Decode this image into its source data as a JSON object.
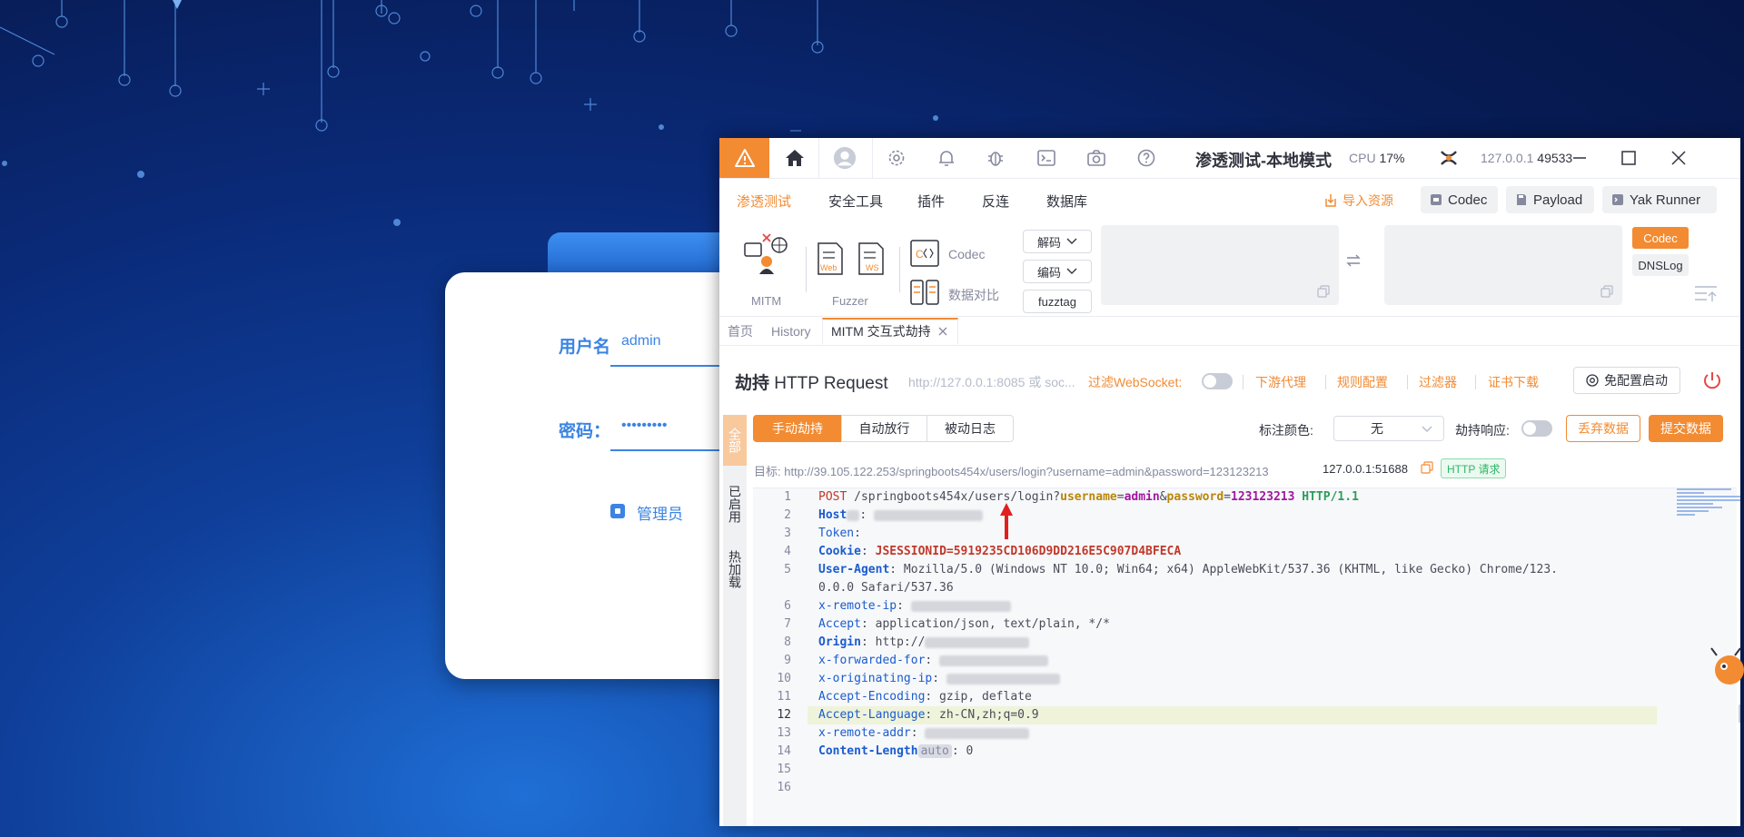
{
  "login": {
    "username_label": "用户名",
    "username_value": "admin",
    "password_label": "密码：",
    "password_value": "•••••••••",
    "role_label": "管理员"
  },
  "titlebar": {
    "title": "渗透测试-本地模式",
    "cpu_label": "CPU",
    "cpu_value": "17%",
    "address": "127.0.0.1",
    "port": "49533"
  },
  "menu": {
    "items": [
      "渗透测试",
      "安全工具",
      "插件",
      "反连",
      "数据库"
    ],
    "import_label": "导入资源",
    "codec_label": "Codec",
    "payload_label": "Payload",
    "yakrunner_label": "Yak Runner"
  },
  "tools": {
    "mitm_label": "MITM",
    "fuzzer_label": "Fuzzer",
    "codec_label": "Codec",
    "compare_label": "数据对比",
    "decode_label": "解码",
    "encode_label": "编码",
    "fuzztag_label": "fuzztag",
    "side_codec": "Codec",
    "side_dnslog": "DNSLog"
  },
  "tabs": [
    "首页",
    "History",
    "MITM 交互式劫持"
  ],
  "hijack": {
    "title_bold": "劫持",
    "title_rest": " HTTP Request",
    "placeholder": "http://127.0.0.1:8085 或 soc...",
    "ws_label": "过滤WebSocket:",
    "downstream": "下游代理",
    "rules": "规则配置",
    "filter": "过滤器",
    "cert": "证书下载",
    "free_start": "免配置启动"
  },
  "vtabs": [
    "全部",
    "已启用",
    "热加载"
  ],
  "modes": [
    "手动劫持",
    "自动放行",
    "被动日志"
  ],
  "actions": {
    "color_label": "标注颜色:",
    "color_value": "无",
    "hijack_resp_label": "劫持响应:",
    "discard": "丢弃数据",
    "submit": "提交数据"
  },
  "target": {
    "label": "目标:",
    "url": "http://39.105.122.253/springboots454x/users/login?username=admin&password=123123213",
    "source": "127.0.0.1:51688",
    "tag": "HTTP 请求"
  },
  "request": {
    "method": "POST",
    "path": "/springboots454x/users/login?",
    "p1k": "username",
    "p1v": "admin",
    "p2k": "password",
    "p2v": "123123213",
    "version": "HTTP/1.1",
    "h_host": "Host",
    "h_token": "Token",
    "h_cookie": "Cookie",
    "cookie_val": "JSESSIONID=5919235CD106D9DD216E5C907D4BFECA",
    "h_ua": "User-Agent",
    "ua_val1": "Mozilla/5.0 (Windows NT 10.0; Win64; x64) AppleWebKit/537.36 (KHTML, like Gecko) Chrome/123.",
    "ua_val2": "0.0.0 Safari/537.36",
    "h_xrip": "x-remote-ip",
    "h_accept": "Accept",
    "accept_val": "application/json, text/plain, */*",
    "h_origin": "Origin",
    "origin_val": "http://",
    "h_xff": "x-forwarded-for",
    "h_xoip": "x-originating-ip",
    "h_ae": "Accept-Encoding",
    "ae_val": "gzip, deflate",
    "h_al": "Accept-Language",
    "al_val": "zh-CN,zh;q=0.9",
    "h_xra": "x-remote-addr",
    "h_cl": "Content-Length",
    "cl_tag": "auto",
    "cl_val": "0"
  },
  "line_numbers": [
    "1",
    "2",
    "3",
    "4",
    "5",
    "6",
    "7",
    "8",
    "9",
    "10",
    "11",
    "12",
    "13",
    "14",
    "15",
    "16"
  ],
  "colors": {
    "accent": "#f28b32",
    "link_blue": "#3b84e3"
  }
}
